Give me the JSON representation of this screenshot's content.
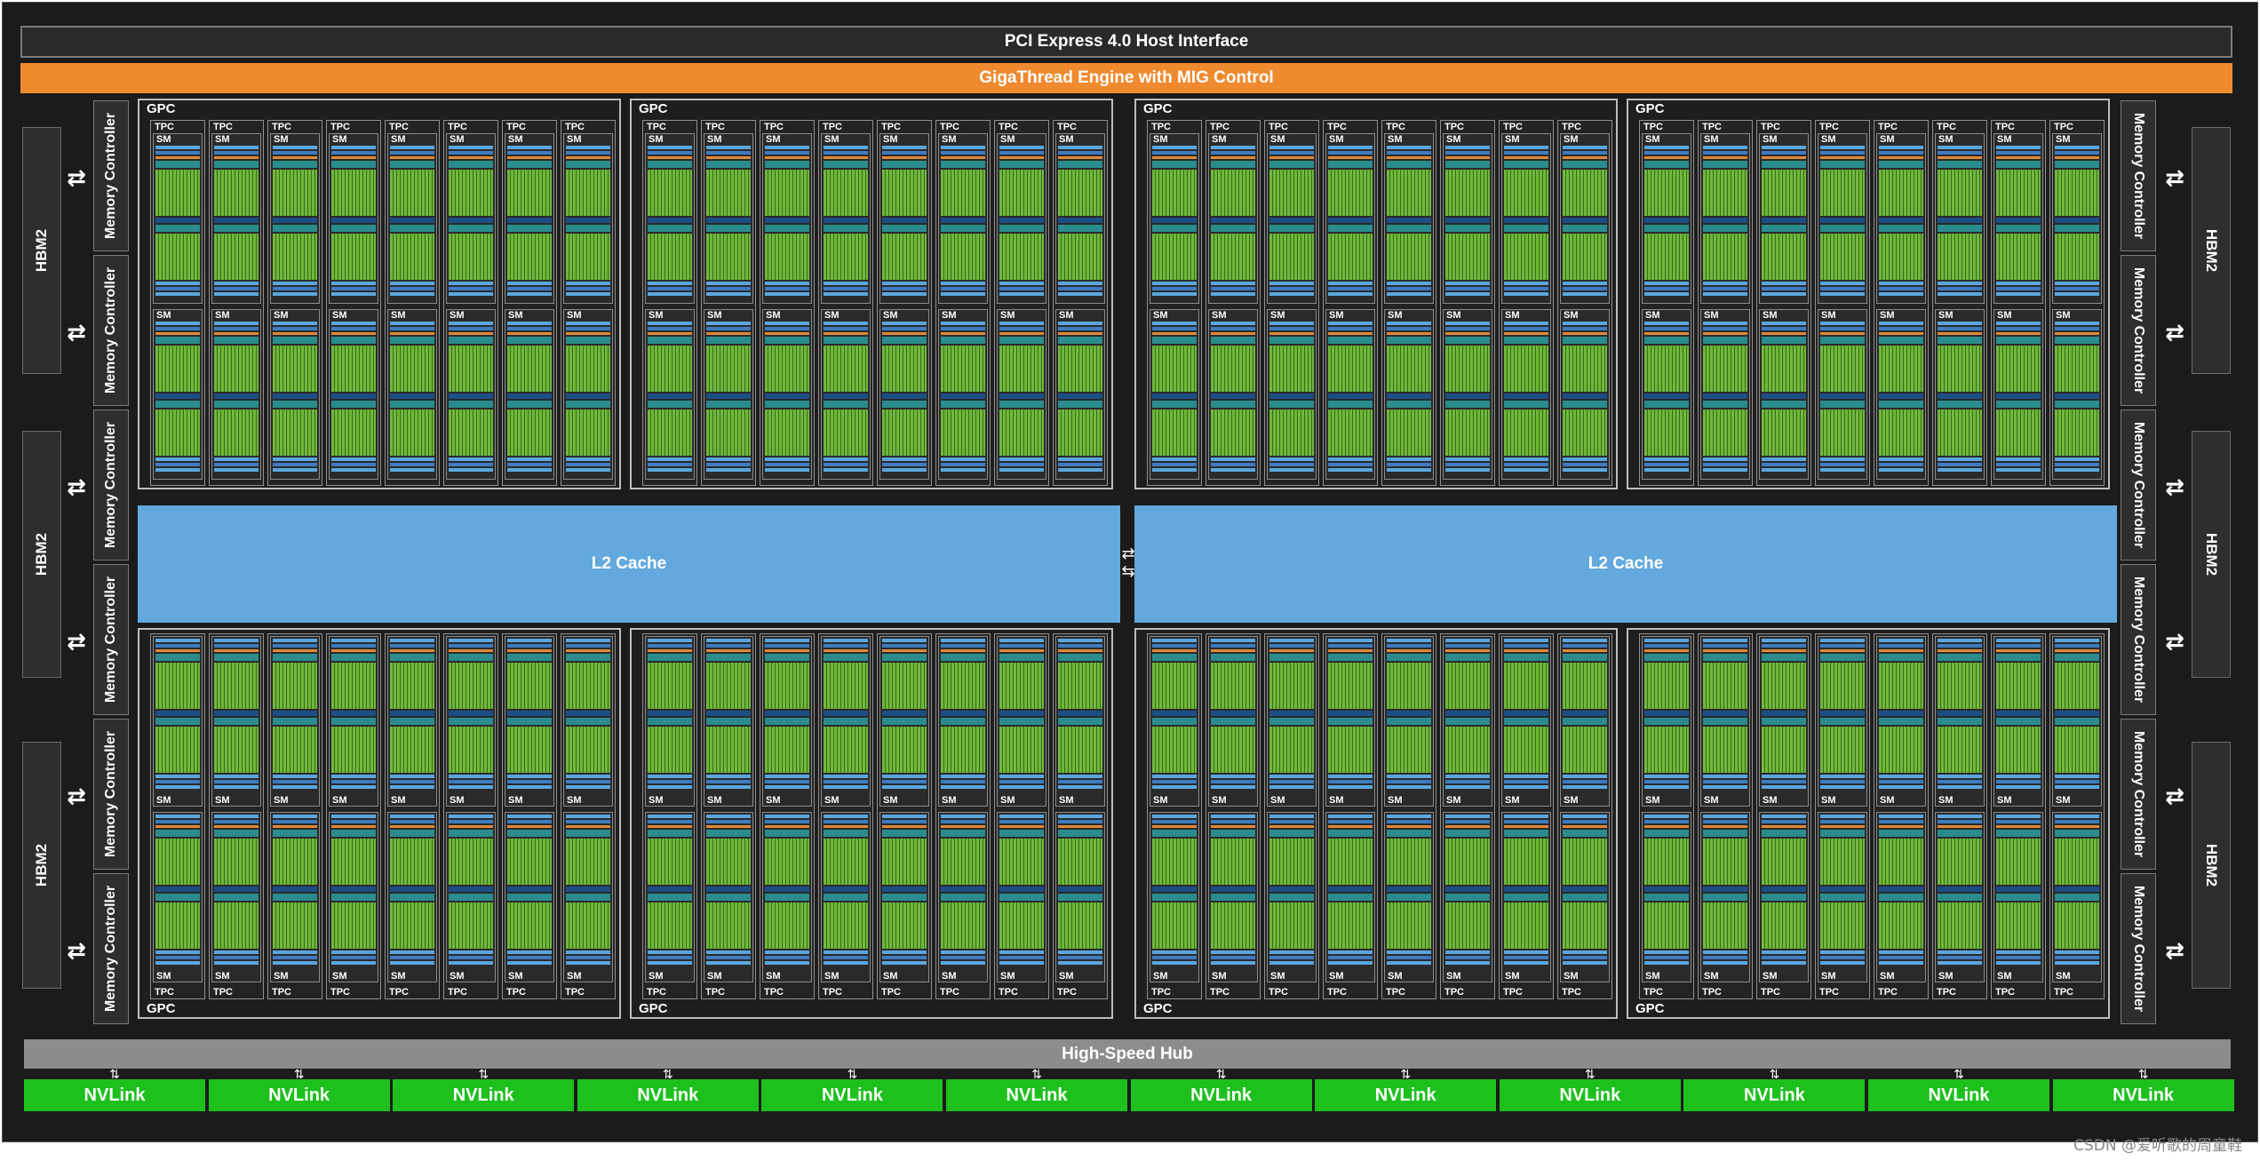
{
  "header": {
    "host_interface": "PCI Express 4.0 Host Interface",
    "engine": "GigaThread Engine with MIG Control"
  },
  "hub": "High-Speed Hub",
  "l2": [
    "L2 Cache",
    "L2 Cache"
  ],
  "hbm_label": "HBM2",
  "memory_controller_label": "Memory Controller",
  "gpc_label": "GPC",
  "tpc_label": "TPC",
  "sm_label": "SM",
  "nvlink_label": "NVLink",
  "nvlink_count": 12,
  "watermark": "CSDN @爱听歌的周童鞋",
  "colors": {
    "background": "#1b1b1b",
    "engine": "#f08a2f",
    "l2": "#63a9dd",
    "nvlink": "#1ec01e",
    "hub": "#8c8c8c",
    "cuda_core": "#6fb83a"
  }
}
